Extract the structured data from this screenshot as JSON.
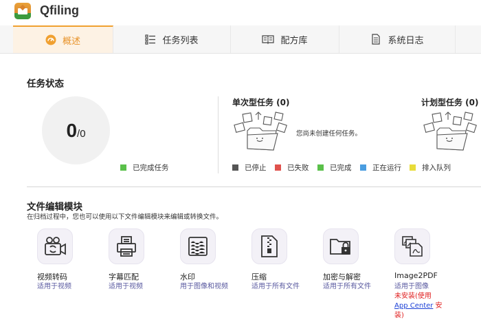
{
  "app": {
    "title": "Qfiling"
  },
  "tabs": [
    {
      "label": "概述",
      "icon": "dashboard-icon"
    },
    {
      "label": "任务列表",
      "icon": "task-list-icon"
    },
    {
      "label": "配方库",
      "icon": "recipe-book-icon"
    },
    {
      "label": "系统日志",
      "icon": "log-icon"
    }
  ],
  "task_status": {
    "title": "任务状态",
    "completed": "0",
    "total": "/0",
    "legend_completed": "已完成任务"
  },
  "single_task": {
    "title": "单次型任务 (0)",
    "empty_message": "您尚未创建任何任务。"
  },
  "scheduled_task": {
    "title": "计划型任务 (0)"
  },
  "status_legend": [
    {
      "label": "已停止",
      "color": "#555555"
    },
    {
      "label": "已失败",
      "color": "#e0524d"
    },
    {
      "label": "已完成",
      "color": "#5ac04a"
    },
    {
      "label": "正在运行",
      "color": "#4a9de0"
    },
    {
      "label": "排入队列",
      "color": "#e8dc3a"
    }
  ],
  "modules": {
    "title": "文件编辑模块",
    "subtitle": "在归档过程中，您也可以使用以下文件编辑模块来编辑或转换文件。",
    "items": [
      {
        "name": "视频转码",
        "desc": "适用于视频",
        "icon": "video-transcode-icon"
      },
      {
        "name": "字幕匹配",
        "desc": "适用于视频",
        "icon": "subtitle-printer-icon"
      },
      {
        "name": "水印",
        "desc": "用于图像和视频",
        "icon": "watermark-icon"
      },
      {
        "name": "压缩",
        "desc": "适用于所有文件",
        "icon": "zip-file-icon"
      },
      {
        "name": "加密与解密",
        "desc": "适用于所有文件",
        "icon": "folder-lock-icon"
      },
      {
        "name": "Image2PDF",
        "desc": "适用于图像",
        "icon": "image-to-pdf-icon",
        "status_prefix": "未安装(使用",
        "status_link": "App Center",
        "status_suffix": " 安装)"
      }
    ]
  }
}
